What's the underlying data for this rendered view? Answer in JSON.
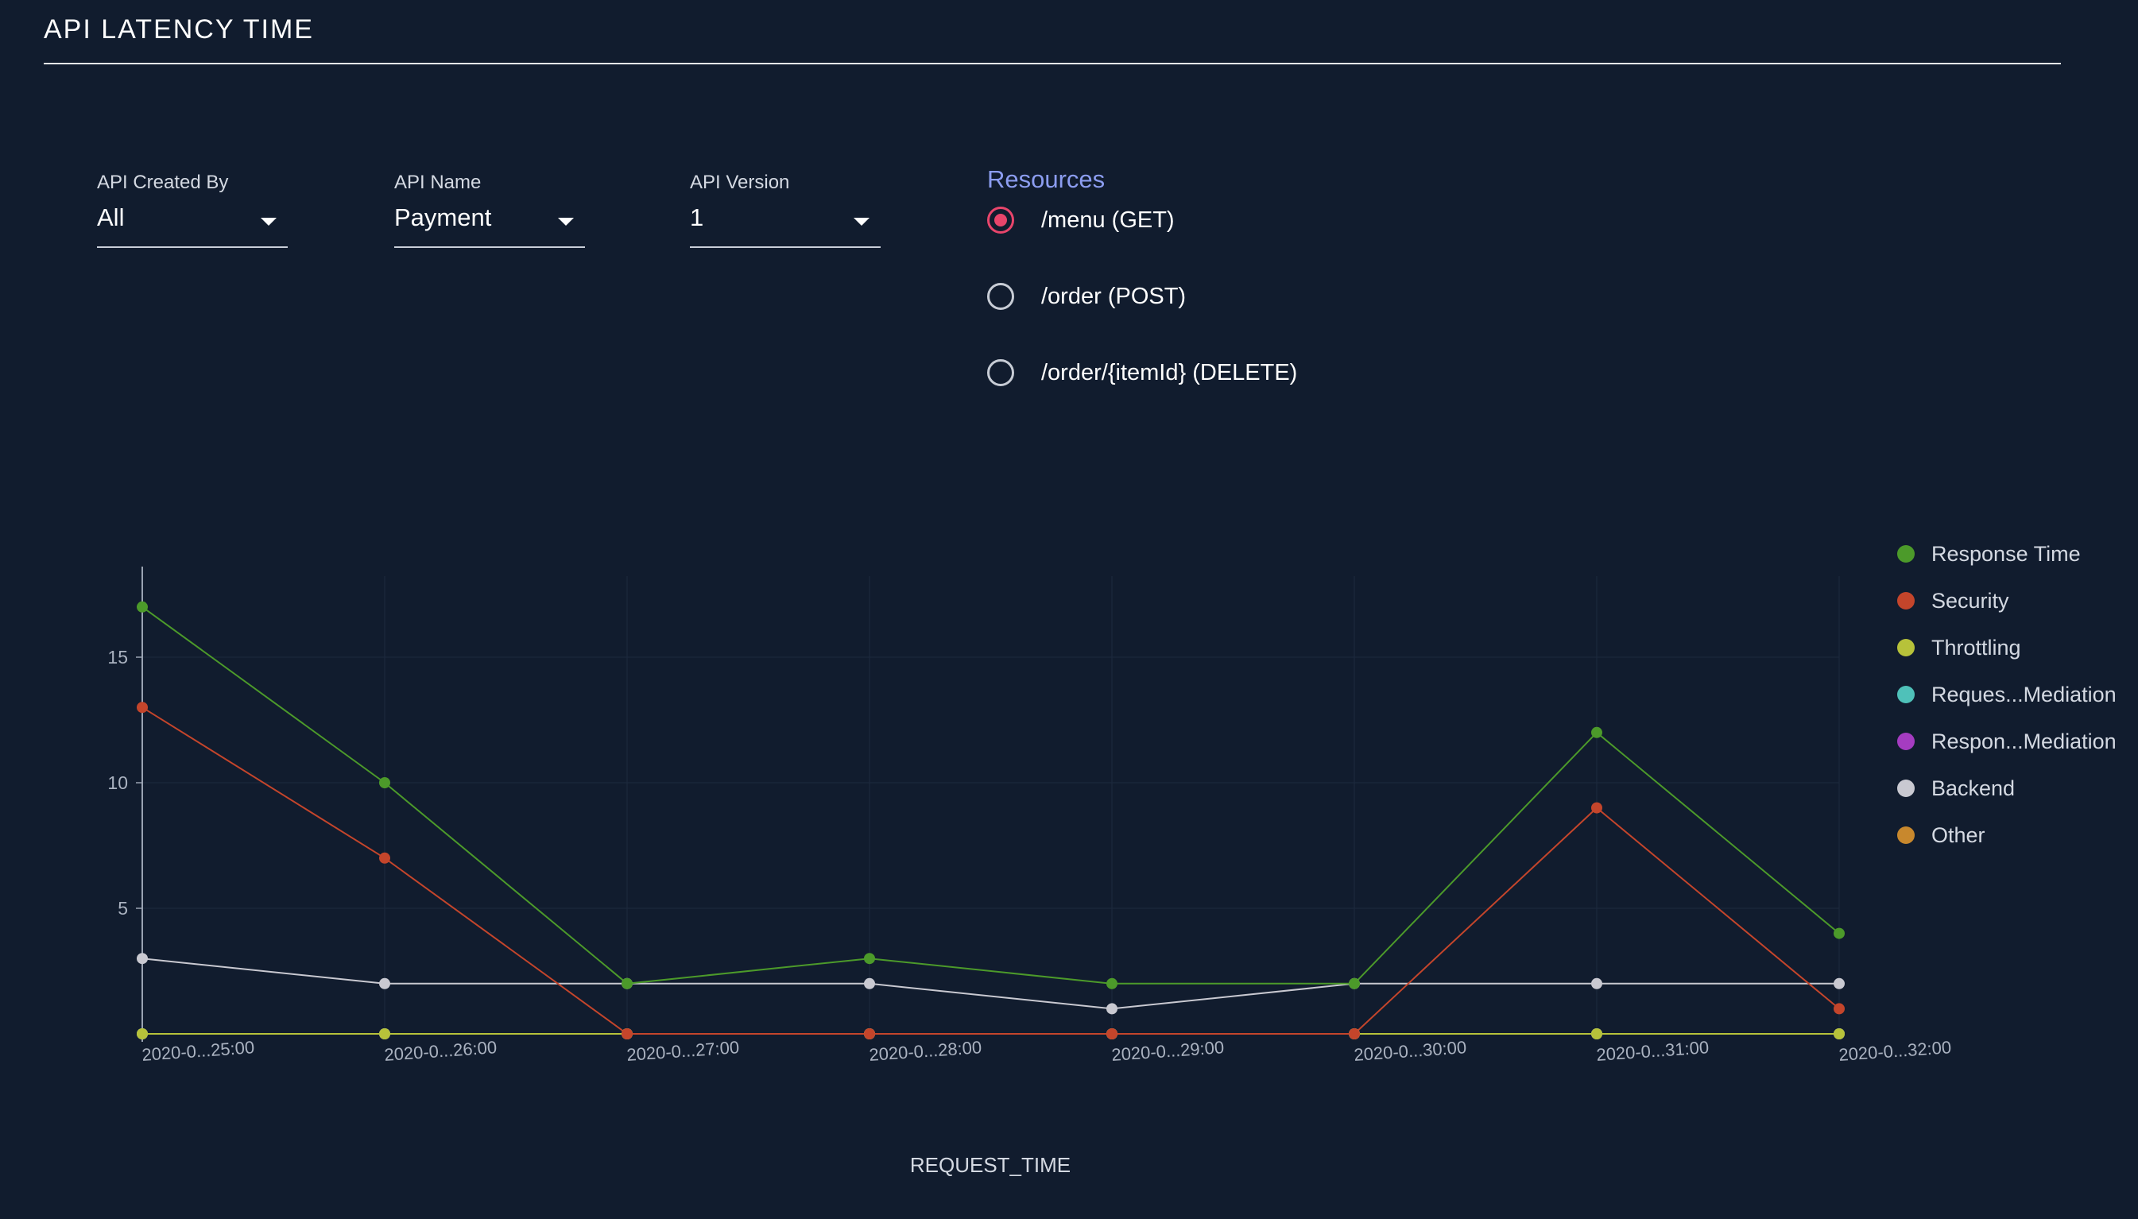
{
  "page": {
    "title": "API LATENCY TIME"
  },
  "filters": {
    "created_by": {
      "label": "API Created By",
      "value": "All"
    },
    "api_name": {
      "label": "API Name",
      "value": "Payment"
    },
    "api_version": {
      "label": "API Version",
      "value": "1"
    }
  },
  "resources": {
    "heading": "Resources",
    "items": [
      {
        "label": "/menu (GET)",
        "selected": true
      },
      {
        "label": "/order (POST)",
        "selected": false
      },
      {
        "label": "/order/{itemId} (DELETE)",
        "selected": false
      }
    ]
  },
  "chart_data": {
    "type": "line",
    "title": "",
    "xlabel": "REQUEST_TIME",
    "ylabel": "",
    "categories": [
      "2020-0...25:00",
      "2020-0...26:00",
      "2020-0...27:00",
      "2020-0...28:00",
      "2020-0...29:00",
      "2020-0...30:00",
      "2020-0...31:00",
      "2020-0...32:00"
    ],
    "yticks": [
      5,
      10,
      15
    ],
    "ylim": [
      0,
      17.6
    ],
    "grid": true,
    "legend_position": "right",
    "series": [
      {
        "name": "Response Time",
        "color": "#4c9a2a",
        "values": [
          17,
          10,
          2,
          3,
          2,
          2,
          12,
          4
        ]
      },
      {
        "name": "Security",
        "color": "#c4452b",
        "values": [
          13,
          7,
          0,
          0,
          0,
          0,
          9,
          1
        ]
      },
      {
        "name": "Throttling",
        "color": "#b7c23a",
        "values": [
          0,
          0,
          0,
          0,
          0,
          0,
          0,
          0
        ]
      },
      {
        "name": "Reques...Mediation",
        "color": "#4fc1b9",
        "values": [
          0,
          0,
          0,
          0,
          0,
          0,
          0,
          0
        ]
      },
      {
        "name": "Respon...Mediation",
        "color": "#a53cc1",
        "values": [
          0,
          0,
          0,
          0,
          0,
          0,
          0,
          0
        ]
      },
      {
        "name": "Backend",
        "color": "#c9c9d1",
        "values": [
          3,
          2,
          2,
          2,
          1,
          2,
          2,
          2
        ]
      },
      {
        "name": "Other",
        "color": "#c8882d",
        "values": [
          0,
          0,
          0,
          0,
          0,
          0,
          0,
          0
        ]
      }
    ]
  }
}
